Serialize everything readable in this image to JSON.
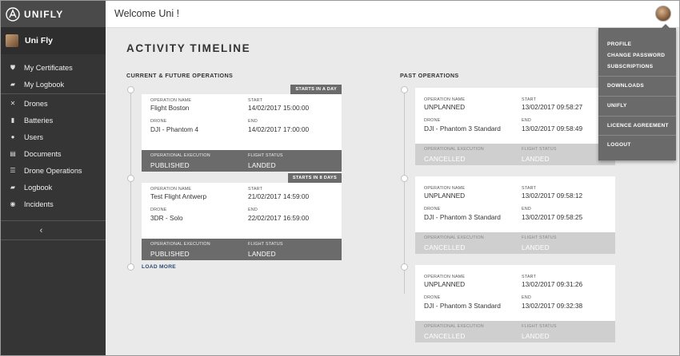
{
  "app": {
    "brand": "UNIFLY",
    "welcome": "Welcome Uni !"
  },
  "sidebar": {
    "user_name": "Uni Fly",
    "items": [
      {
        "label": "My Certificates",
        "icon": "shield-icon"
      },
      {
        "label": "My Logbook",
        "icon": "book-icon"
      },
      {
        "label": "Drones",
        "icon": "drone-icon"
      },
      {
        "label": "Batteries",
        "icon": "battery-icon"
      },
      {
        "label": "Users",
        "icon": "user-icon"
      },
      {
        "label": "Documents",
        "icon": "document-icon"
      },
      {
        "label": "Drone Operations",
        "icon": "list-icon"
      },
      {
        "label": "Logbook",
        "icon": "book-icon"
      },
      {
        "label": "Incidents",
        "icon": "alert-icon"
      }
    ],
    "collapse_glyph": "‹"
  },
  "main": {
    "title": "ACTIVITY TIMELINE",
    "current_title": "CURRENT & FUTURE OPERATIONS",
    "past_title": "PAST OPERATIONS",
    "load_more": "LOAD MORE",
    "labels": {
      "operation_name": "OPERATION NAME",
      "start": "START",
      "drone": "DRONE",
      "end": "END",
      "operational_execution": "OPERATIONAL EXECUTION",
      "flight_status": "FLIGHT STATUS"
    },
    "current": [
      {
        "badge": "STARTS IN A DAY",
        "name": "Flight Boston",
        "start": "14/02/2017 15:00:00",
        "drone": "DJI - Phantom 4",
        "end": "14/02/2017 17:00:00",
        "execution": "PUBLISHED",
        "status": "LANDED"
      },
      {
        "badge": "STARTS IN 8 DAYS",
        "name": "Test Flight Antwerp",
        "start": "21/02/2017 14:59:00",
        "drone": "3DR - Solo",
        "end": "22/02/2017 16:59:00",
        "execution": "PUBLISHED",
        "status": "LANDED"
      }
    ],
    "past": [
      {
        "name": "UNPLANNED",
        "start": "13/02/2017 09:58:27",
        "drone": "DJI - Phantom 3 Standard",
        "end": "13/02/2017 09:58:49",
        "execution": "CANCELLED",
        "status": "LANDED"
      },
      {
        "name": "UNPLANNED",
        "start": "13/02/2017 09:58:12",
        "drone": "DJI - Phantom 3 Standard",
        "end": "13/02/2017 09:58:25",
        "execution": "CANCELLED",
        "status": "LANDED"
      },
      {
        "name": "UNPLANNED",
        "start": "13/02/2017 09:31:26",
        "drone": "DJI - Phantom 3 Standard",
        "end": "13/02/2017 09:32:38",
        "execution": "CANCELLED",
        "status": "LANDED"
      }
    ]
  },
  "dropdown": {
    "items": [
      "PROFILE",
      "CHANGE PASSWORD",
      "SUBSCRIPTIONS",
      "DOWNLOADS",
      "UNIFLY",
      "LICENCE AGREEMENT",
      "LOGOUT"
    ]
  },
  "colors": {
    "sidebar": "#353535",
    "card_footer_dark": "#6b6b6b",
    "card_footer_light": "#cfcfcf",
    "dropdown": "#6a6a6a",
    "link": "#2c4a6e"
  }
}
